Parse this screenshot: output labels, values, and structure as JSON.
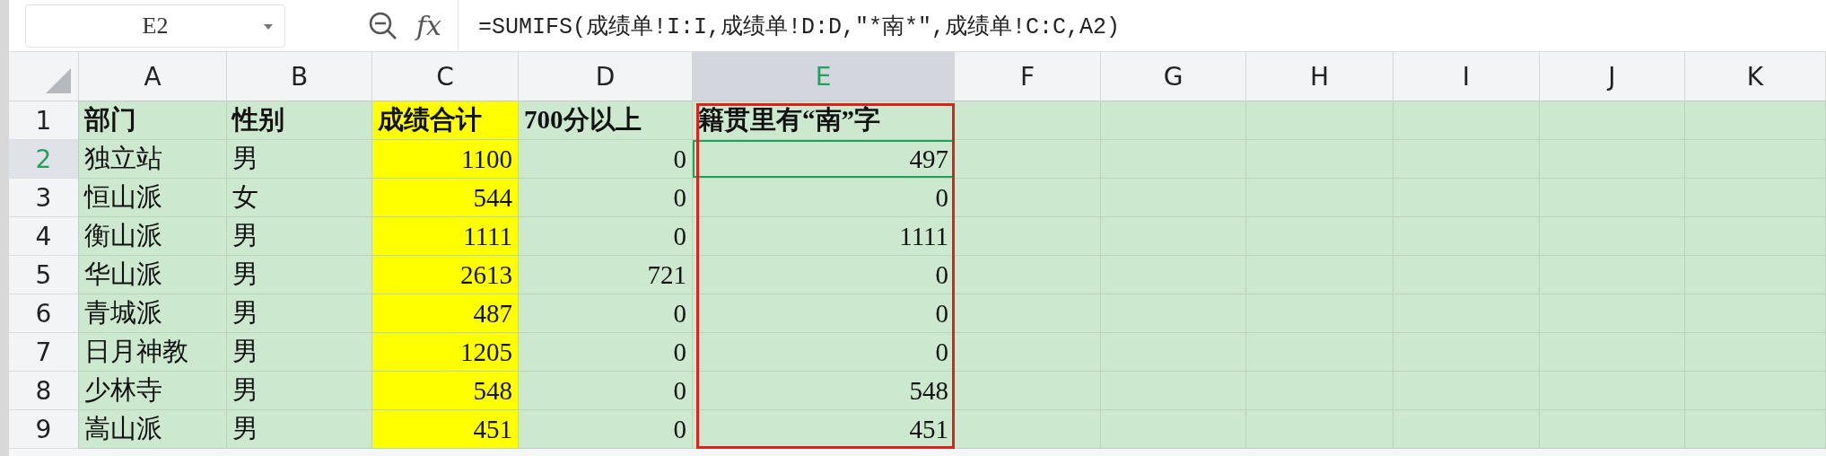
{
  "name_box": "E2",
  "fx_label": "fx",
  "formula": "=SUMIFS(成绩单!I:I,成绩单!D:D,\"*南*\",成绩单!C:C,A2)",
  "columns": [
    {
      "label": "A",
      "selected": false,
      "outlined": false
    },
    {
      "label": "B",
      "selected": false,
      "outlined": false
    },
    {
      "label": "C",
      "selected": false,
      "outlined": false
    },
    {
      "label": "D",
      "selected": false,
      "outlined": false
    },
    {
      "label": "E",
      "selected": true,
      "outlined": true
    },
    {
      "label": "F",
      "selected": false,
      "outlined": false
    },
    {
      "label": "G",
      "selected": false,
      "outlined": false
    },
    {
      "label": "H",
      "selected": false,
      "outlined": false
    },
    {
      "label": "I",
      "selected": false,
      "outlined": false
    },
    {
      "label": "J",
      "selected": false,
      "outlined": false
    },
    {
      "label": "K",
      "selected": false,
      "outlined": false
    }
  ],
  "rows": [
    {
      "label": "1",
      "selected": false,
      "kind": "header",
      "cells": [
        {
          "text": "部门",
          "highlighted": false
        },
        {
          "text": "性别",
          "highlighted": false
        },
        {
          "text": "成绩合计",
          "highlighted": true
        },
        {
          "text": "700分以上",
          "highlighted": false
        },
        {
          "text": "籍贯里有“南”字",
          "highlighted": false
        }
      ]
    },
    {
      "label": "2",
      "selected": true,
      "kind": "data",
      "cells": [
        {
          "text": "独立站",
          "highlighted": false
        },
        {
          "text": "男",
          "highlighted": false
        },
        {
          "text": "1100",
          "highlighted": true
        },
        {
          "text": "0",
          "highlighted": false
        },
        {
          "text": "497",
          "highlighted": false
        }
      ]
    },
    {
      "label": "3",
      "selected": false,
      "kind": "data",
      "cells": [
        {
          "text": "恒山派",
          "highlighted": false
        },
        {
          "text": "女",
          "highlighted": false
        },
        {
          "text": "544",
          "highlighted": true
        },
        {
          "text": "0",
          "highlighted": false
        },
        {
          "text": "0",
          "highlighted": false
        }
      ]
    },
    {
      "label": "4",
      "selected": false,
      "kind": "data",
      "cells": [
        {
          "text": "衡山派",
          "highlighted": false
        },
        {
          "text": "男",
          "highlighted": false
        },
        {
          "text": "1111",
          "highlighted": true
        },
        {
          "text": "0",
          "highlighted": false
        },
        {
          "text": "1111",
          "highlighted": false
        }
      ]
    },
    {
      "label": "5",
      "selected": false,
      "kind": "data",
      "cells": [
        {
          "text": "华山派",
          "highlighted": false
        },
        {
          "text": "男",
          "highlighted": false
        },
        {
          "text": "2613",
          "highlighted": true
        },
        {
          "text": "721",
          "highlighted": false
        },
        {
          "text": "0",
          "highlighted": false
        }
      ]
    },
    {
      "label": "6",
      "selected": false,
      "kind": "data",
      "cells": [
        {
          "text": "青城派",
          "highlighted": false
        },
        {
          "text": "男",
          "highlighted": false
        },
        {
          "text": "487",
          "highlighted": true
        },
        {
          "text": "0",
          "highlighted": false
        },
        {
          "text": "0",
          "highlighted": false
        }
      ]
    },
    {
      "label": "7",
      "selected": false,
      "kind": "data",
      "cells": [
        {
          "text": "日月神教",
          "highlighted": false
        },
        {
          "text": "男",
          "highlighted": false
        },
        {
          "text": "1205",
          "highlighted": true
        },
        {
          "text": "0",
          "highlighted": false
        },
        {
          "text": "0",
          "highlighted": false
        }
      ]
    },
    {
      "label": "8",
      "selected": false,
      "kind": "data",
      "cells": [
        {
          "text": "少林寺",
          "highlighted": false
        },
        {
          "text": "男",
          "highlighted": false
        },
        {
          "text": "548",
          "highlighted": true
        },
        {
          "text": "0",
          "highlighted": false
        },
        {
          "text": "548",
          "highlighted": false
        }
      ]
    },
    {
      "label": "9",
      "selected": false,
      "kind": "data",
      "cells": [
        {
          "text": "嵩山派",
          "highlighted": false
        },
        {
          "text": "男",
          "highlighted": false
        },
        {
          "text": "451",
          "highlighted": true
        },
        {
          "text": "0",
          "highlighted": false
        },
        {
          "text": "451",
          "highlighted": false
        }
      ]
    }
  ]
}
